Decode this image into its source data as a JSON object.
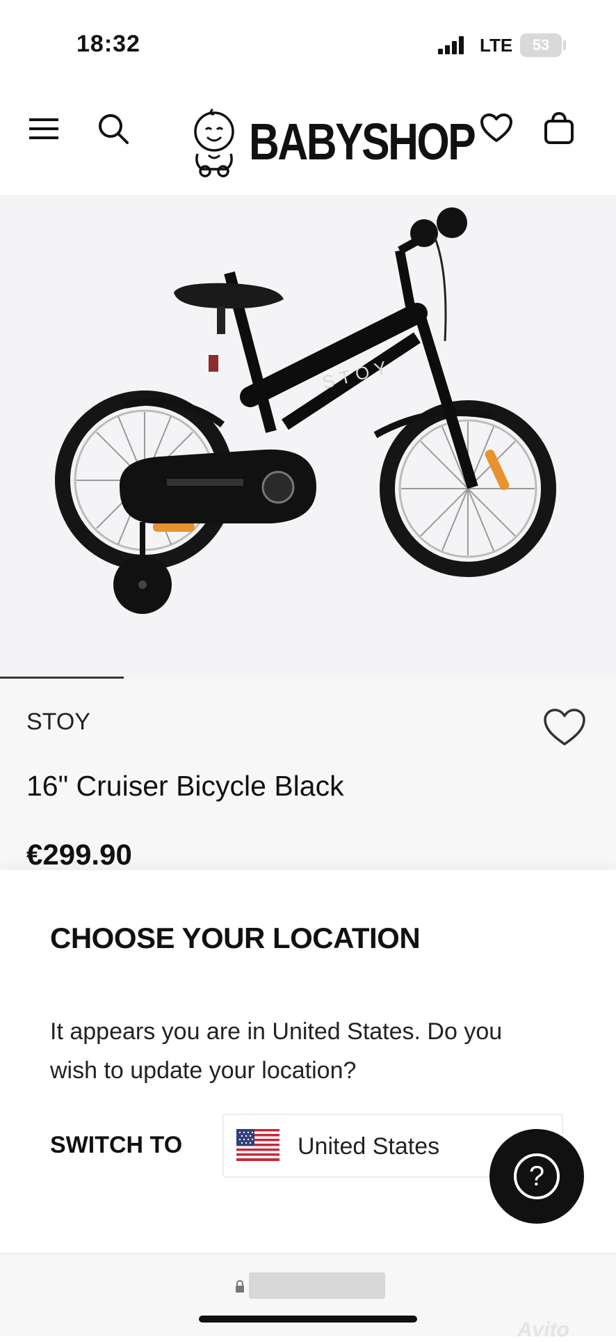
{
  "status_bar": {
    "time": "18:32",
    "network": "LTE",
    "battery": "53"
  },
  "header": {
    "brand_name": "BABYSHOP",
    "icons": [
      "menu-icon",
      "search-icon",
      "heart-icon",
      "bag-icon"
    ]
  },
  "hero": {
    "frame_brand_text": "STOY"
  },
  "product": {
    "brand": "STOY",
    "title": "16\" Cruiser Bicycle Black",
    "price": "€299.90"
  },
  "location_sheet": {
    "title": "CHOOSE YOUR LOCATION",
    "message": "It appears you are in United States. Do you wish to update your location?",
    "switch_label": "SWITCH TO",
    "country": "United States"
  },
  "help_button": {
    "glyph": "?"
  },
  "watermark": "Avito"
}
